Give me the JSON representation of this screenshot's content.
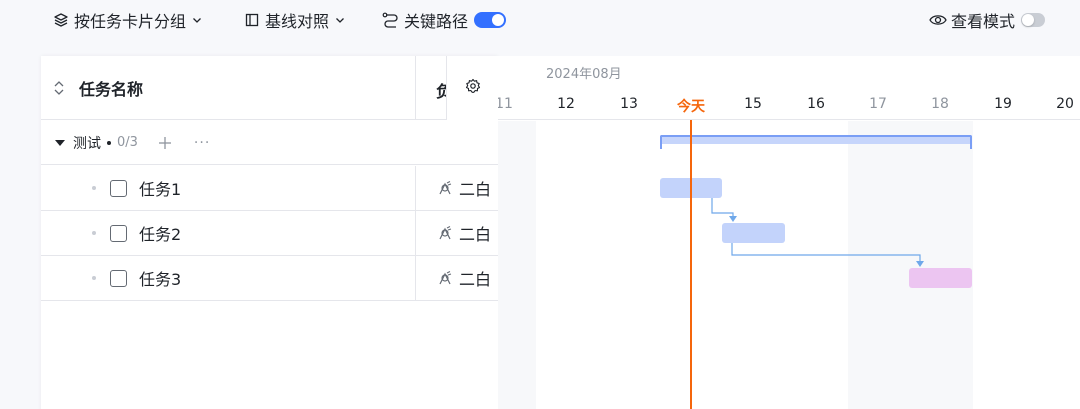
{
  "toolbar": {
    "group_by_label": "按任务卡片分组",
    "baseline_label": "基线对照",
    "critical_path_label": "关键路径",
    "critical_path_on": true,
    "view_mode_label": "查看模式",
    "view_mode_on": false
  },
  "table": {
    "name_header": "任务名称",
    "owner_header": "负责人",
    "group": {
      "name": "测试",
      "count": "0/3",
      "more": "···"
    },
    "tasks": [
      {
        "name": "任务1",
        "owner": "二白"
      },
      {
        "name": "任务2",
        "owner": "二白"
      },
      {
        "name": "任务3",
        "owner": "二白"
      }
    ]
  },
  "timeline": {
    "month": "2024年08月",
    "today_label": "今天",
    "days": [
      "11",
      "12",
      "13",
      "今天",
      "15",
      "16",
      "17",
      "18",
      "19",
      "20"
    ],
    "weekend_days": [
      "11",
      "17",
      "18"
    ]
  },
  "colors": {
    "accent": "#3370ff",
    "today": "#f5660c",
    "task_bar": "#c3d3fb",
    "critical_bar": "#ecc5f1",
    "link": "#6fa8ea"
  }
}
